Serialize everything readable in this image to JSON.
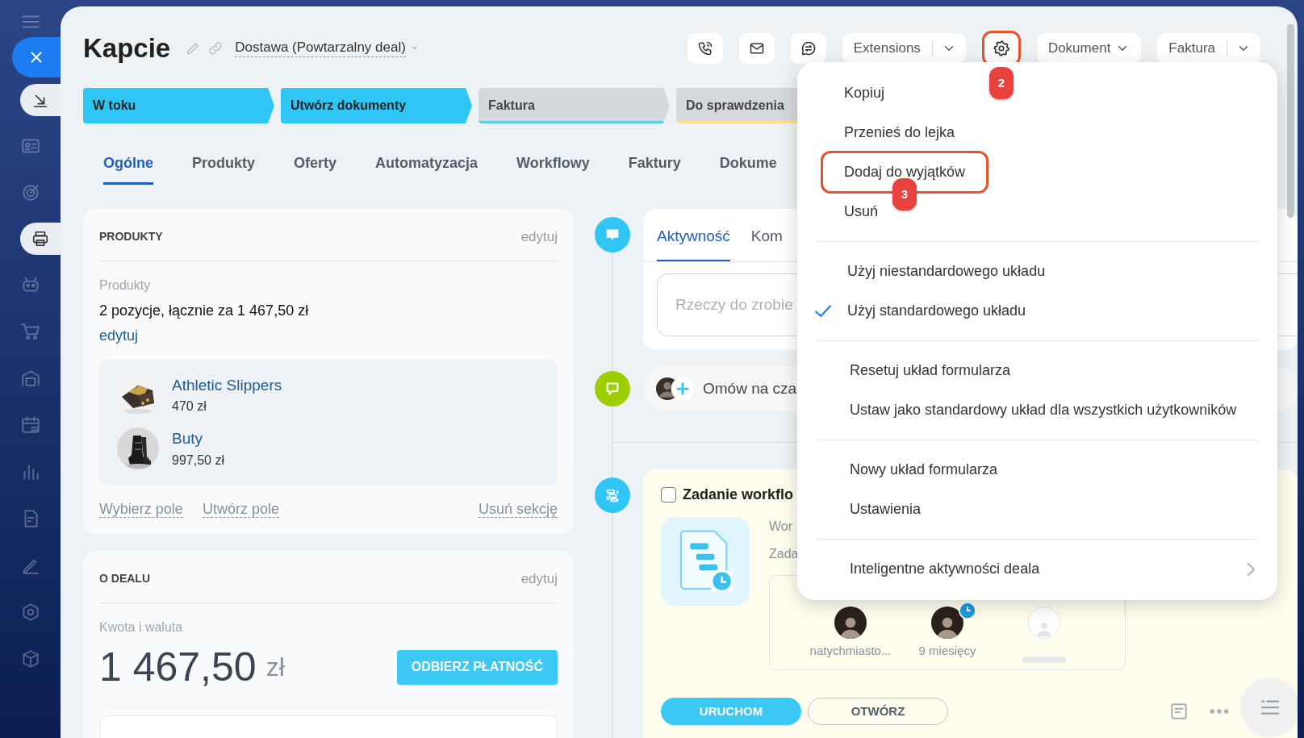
{
  "header": {
    "title": "Kapcie",
    "category": "Dostawa (Powtarzalny deal)"
  },
  "toolbar": {
    "extensions": "Extensions",
    "document": "Dokument",
    "invoice": "Faktura",
    "settings_highlighted": true,
    "settings_annotation": "2"
  },
  "stages": [
    {
      "label": "W toku",
      "reached": true,
      "color": "#2fc6f6"
    },
    {
      "label": "Utwórz dokumenty",
      "reached": true,
      "color": "#2fc6f6"
    },
    {
      "label": "Faktura",
      "reached": false,
      "color": "#55d0e0"
    },
    {
      "label": "Do sprawdzenia",
      "reached": false,
      "color": "#ffe08a"
    }
  ],
  "tabs": [
    {
      "label": "Ogólne",
      "selected": true
    },
    {
      "label": "Produkty",
      "selected": false
    },
    {
      "label": "Oferty",
      "selected": false
    },
    {
      "label": "Automatyzacja",
      "selected": false
    },
    {
      "label": "Workflowy",
      "selected": false
    },
    {
      "label": "Faktury",
      "selected": false
    },
    {
      "label": "Dokume",
      "selected": false
    }
  ],
  "products_section": {
    "title": "PRODUKTY",
    "edit": "edytuj",
    "field_label": "Produkty",
    "summary": "2 pozycje, łącznie za 1 467,50 zł",
    "edit_link": "edytuj",
    "items": [
      {
        "name": "Athletic Slippers",
        "price": "470 zł",
        "kind": "picture"
      },
      {
        "name": "Buty",
        "price": "997,50 zł",
        "kind": "picture"
      }
    ],
    "actions": [
      "Wybierz pole",
      "Utwórz pole"
    ],
    "remove": "Usuń sekcję"
  },
  "deal_section": {
    "title": "O DEALU",
    "edit": "edytuj",
    "field_label": "Kwota i waluta",
    "amount": "1 467,50",
    "currency": "zł",
    "pay_button": "ODBIERZ PŁATNOŚĆ"
  },
  "timeline": {
    "activity_tabs": [
      {
        "label": "Aktywność",
        "selected": true
      },
      {
        "label": "Kom",
        "selected": false
      }
    ],
    "todo_placeholder": "Rzeczy do zrobie",
    "chat_prompt": "Omów na cza",
    "workflow": {
      "checked": false,
      "title": "Zadanie workflo",
      "line_1": "Wor",
      "line_2": "Zada",
      "participants": [
        {
          "kind": "person",
          "caption": "natychmiasto...",
          "pending": false
        },
        {
          "kind": "person",
          "caption": "9 miesięcy",
          "pending": true
        },
        {
          "kind": "empty",
          "pending": false
        }
      ],
      "buttons": [
        "URUCHOM",
        "OTWÓRZ"
      ]
    }
  },
  "menu": {
    "groups": [
      {
        "items": [
          {
            "label": "Kopiuj",
            "highlighted": false
          },
          {
            "label": "Przenieś do lejka",
            "highlighted": false
          },
          {
            "label": "Dodaj do wyjątków",
            "highlighted": true,
            "annotation": "3"
          },
          {
            "label": "Usuń",
            "highlighted": false
          }
        ]
      },
      {
        "items": [
          {
            "label": "Użyj niestandardowego układu",
            "checked": false
          },
          {
            "label": "Użyj standardowego układu",
            "checked": true
          }
        ]
      },
      {
        "items": [
          {
            "label": "Resetuj układ formularza"
          },
          {
            "label": "Ustaw jako standardowy układ dla wszystkich użytkowników"
          }
        ]
      },
      {
        "items": [
          {
            "label": "Nowy układ formularza"
          },
          {
            "label": "Ustawienia"
          }
        ]
      },
      {
        "items": [
          {
            "label": "Inteligentne aktywności deala",
            "has_submenu": true
          }
        ]
      }
    ]
  }
}
